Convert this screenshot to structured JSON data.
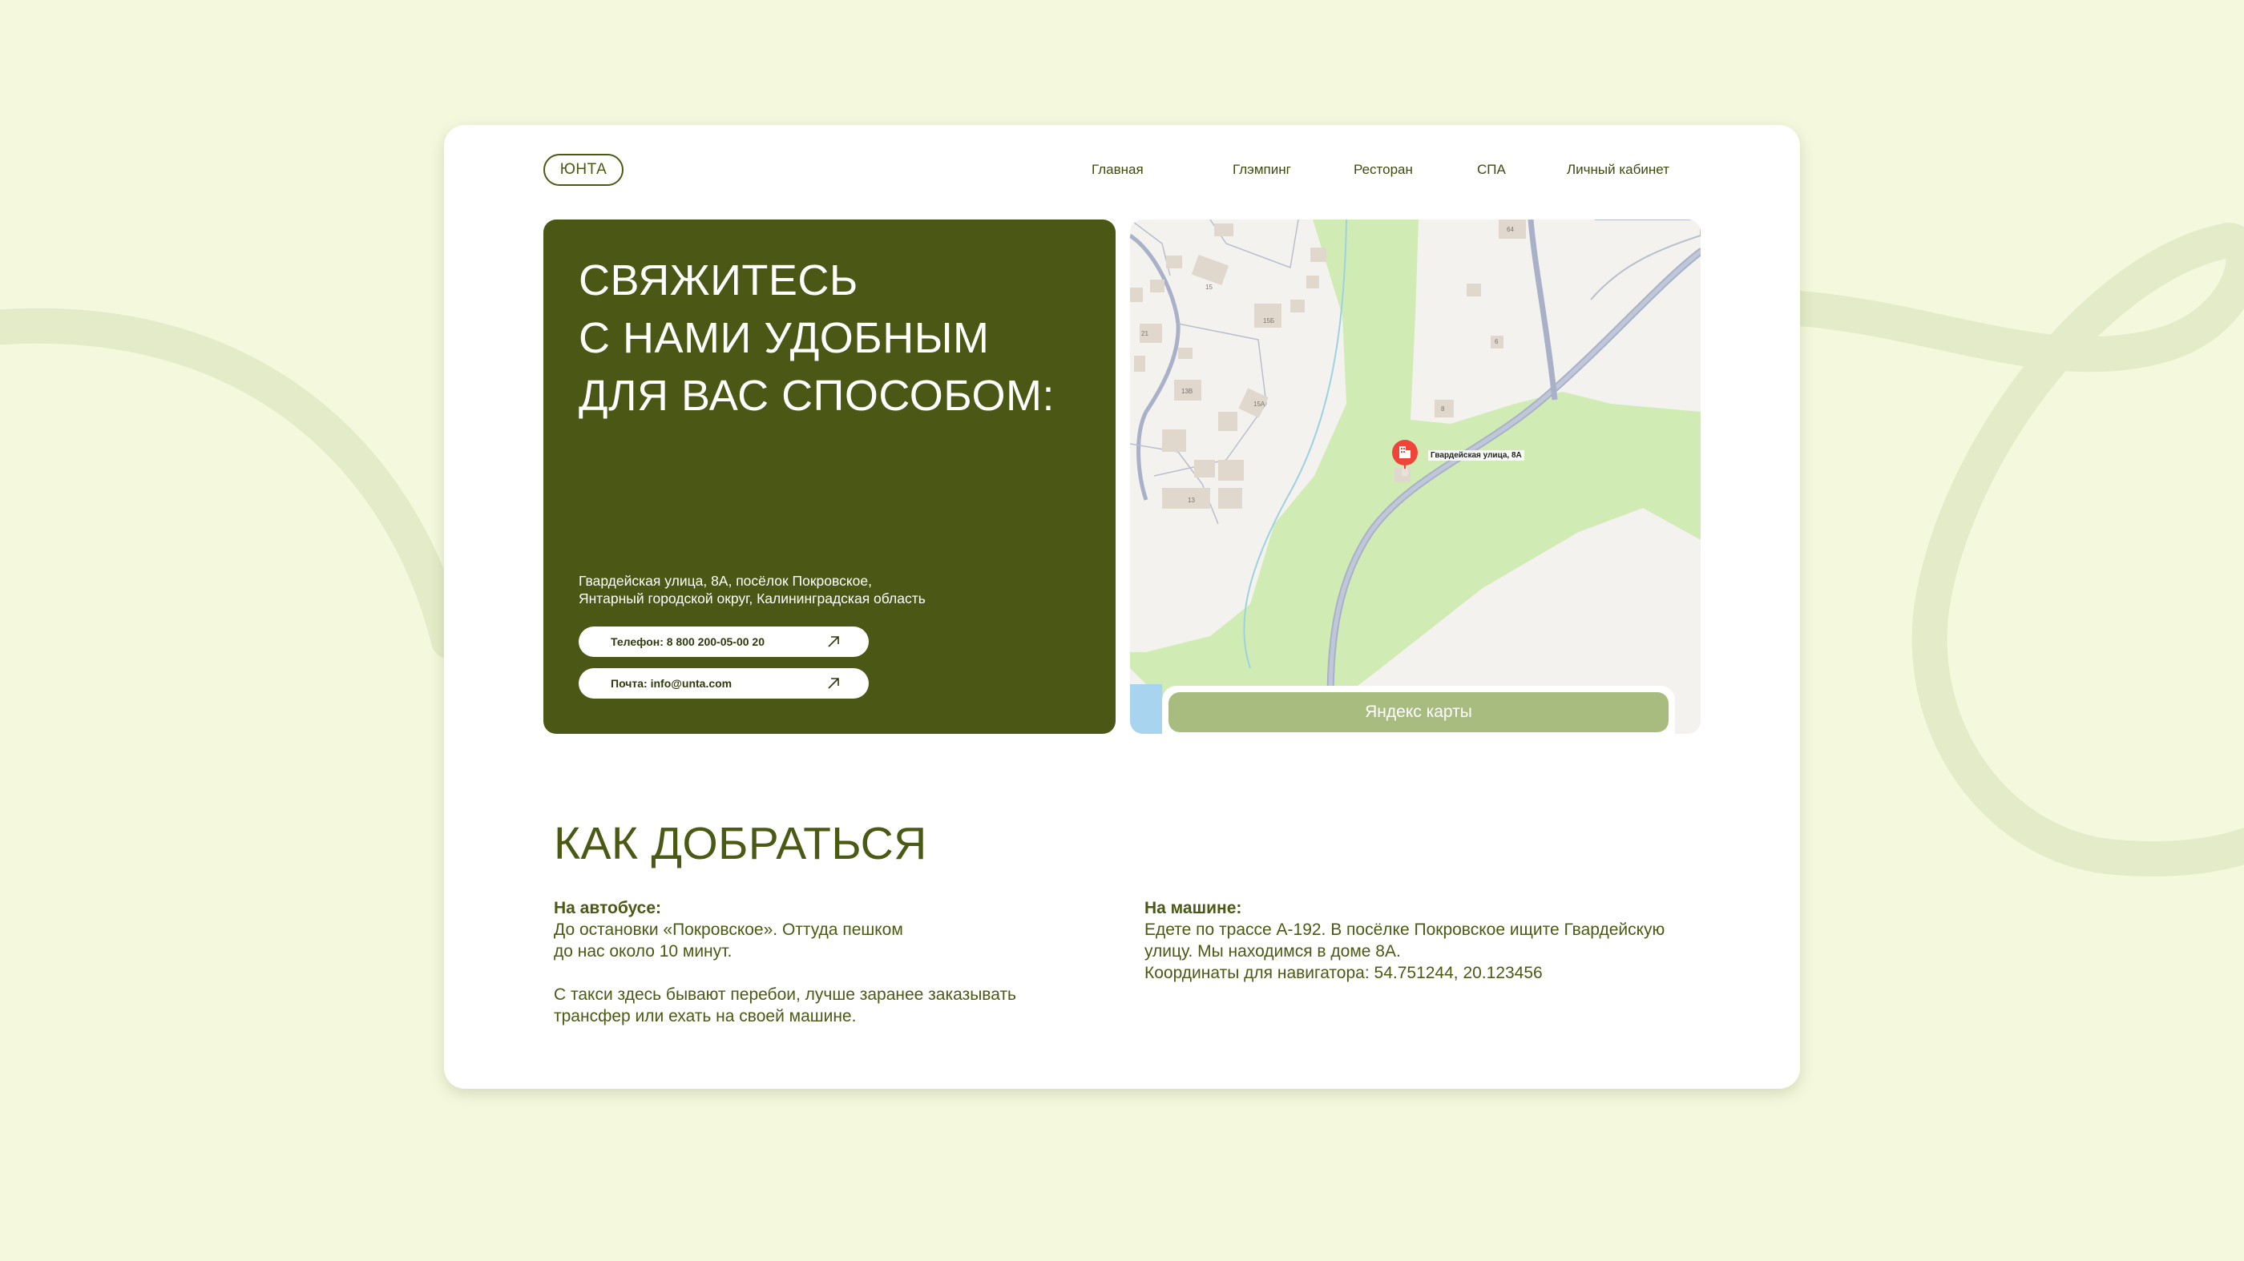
{
  "colors": {
    "page_background": "#f4f8dd",
    "swirl": "#e3ebc8",
    "card": "#ffffff",
    "primary_dark_green": "#4b5714",
    "text_green": "#4a5a14",
    "map_button": "#a8bc80",
    "map_park": "#d1ebb4",
    "pin_red": "#f0433a"
  },
  "header": {
    "logo": "ЮНТА",
    "nav": [
      "Главная",
      "Глэмпинг",
      "Ресторан",
      "СПА",
      "Личный кабинет"
    ]
  },
  "contact": {
    "title": "СВЯЖИТЕСЬ\nС НАМИ УДОБНЫМ\nДЛЯ ВАС СПОСОБОМ:",
    "address": "Гвардейская улица, 8А, посёлок Покровское,\nЯнтарный городской округ, Калининградская область",
    "phone_label": "Телефон: 8 800 200-05-00 20",
    "email_label": "Почта: info@unta.com",
    "arrow_icon": "arrow-up-right-icon"
  },
  "map": {
    "marker_label": "Гвардейская улица, 8А",
    "marker_icon": "building-pin-icon",
    "button_label": "Яндекс карты",
    "house_numbers": [
      "64",
      "15",
      "15Б",
      "21",
      "13В",
      "15А",
      "6",
      "8",
      "13"
    ]
  },
  "directions": {
    "title": "КАК ДОБРАТЬСЯ",
    "bus": {
      "heading": "На автобусе:",
      "text": "До остановки «Покровское». Оттуда пешком\nдо нас около 10 минут.",
      "note": "С такси здесь бывают перебои, лучше заранее заказывать\nтрансфер или ехать на своей машине."
    },
    "car": {
      "heading": "На машине:",
      "text": "Едете по трассе А-192. В посёлке Покровское ищите Гвардейскую\nулицу. Мы находимся в доме 8А.\nКоординаты для навигатора: 54.751244, 20.123456"
    }
  }
}
